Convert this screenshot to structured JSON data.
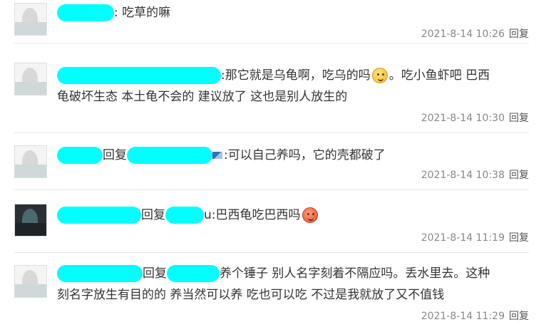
{
  "comments": [
    {
      "text_lines": [
        ": 吃草的嘛"
      ],
      "time": "2021-8-14 10:26",
      "reply_label": "回复"
    },
    {
      "text_lines": [
        ":那它就是乌龟啊，吃乌的吗",
        "。吃小鱼虾吧 巴西",
        "龟破坏生态 本土龟不会的 建议放了 这也是别人放生的"
      ],
      "time": "2021-8-14 10:30",
      "reply_label": "回复"
    },
    {
      "reply_word": "回复",
      "text_lines": [
        ":可以自己养吗，它的壳都破了"
      ],
      "time": "2021-8-14 10:38",
      "reply_label": "回复"
    },
    {
      "reply_word": "回复",
      "text_tail": "u",
      "text_lines": [
        ":巴西龟吃巴西吗"
      ],
      "time": "2021-8-14 11:19",
      "reply_label": "回复"
    },
    {
      "reply_word": "回复",
      "text_lines": [
        "养个锤子 别人名字刻着不隔应吗。丢水里去。这种",
        "刻名字放生有目的的 养当然可以养 吃也可以吃 不过是我就放了又不值钱"
      ],
      "time": "2021-8-14 11:29",
      "reply_label": "回复"
    }
  ],
  "colors": {
    "redaction": "#00ffff",
    "text": "#333333",
    "meta": "#888888",
    "divider": "#e6e6e6"
  },
  "icons": [
    "avatar",
    "emoji-face-icon",
    "emoji-angry-icon",
    "badge-icon"
  ]
}
